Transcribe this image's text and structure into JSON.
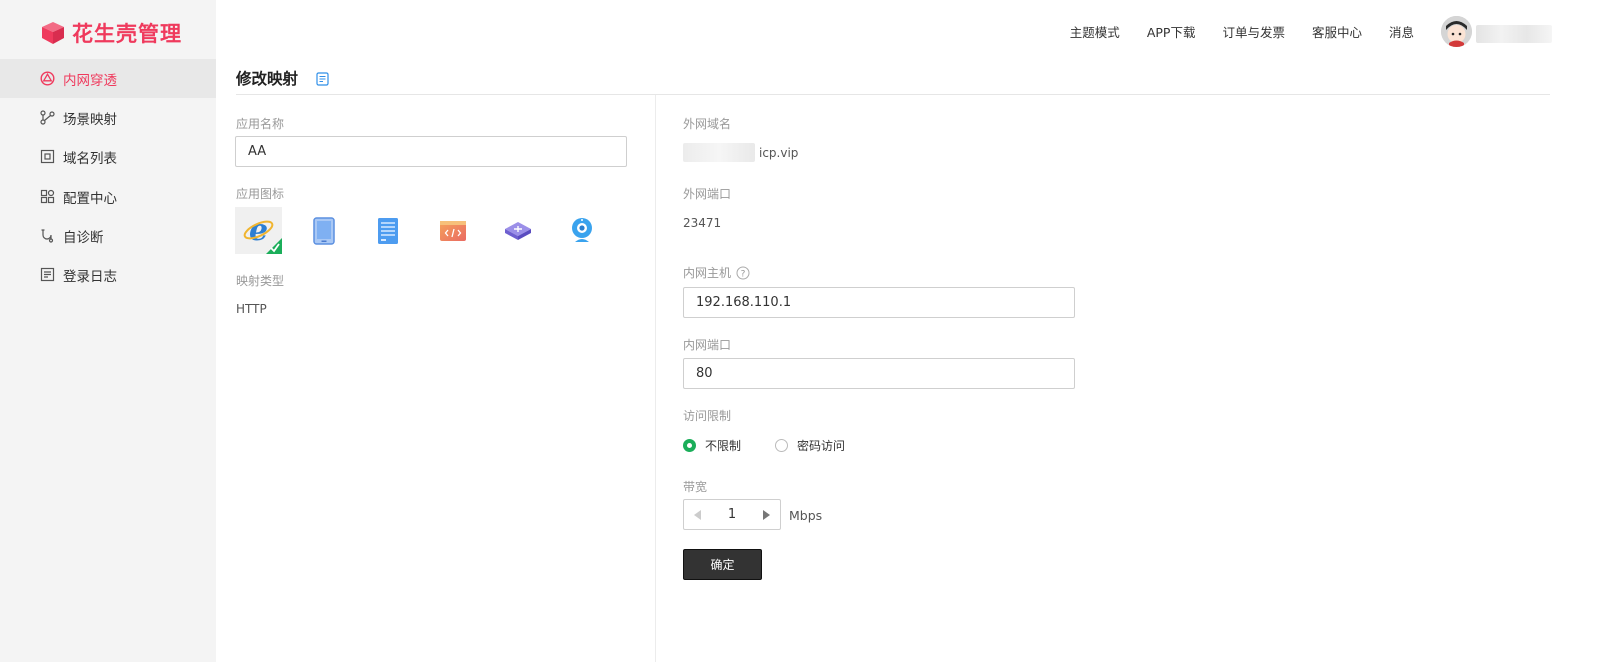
{
  "brand": {
    "name": "花生壳管理",
    "accent": "#ef3a5d"
  },
  "sidebar": {
    "items": [
      {
        "label": "内网穿透",
        "icon": "network-icon",
        "active": true
      },
      {
        "label": "场景映射",
        "icon": "branch-icon",
        "active": false
      },
      {
        "label": "域名列表",
        "icon": "domain-icon",
        "active": false
      },
      {
        "label": "配置中心",
        "icon": "grid-icon",
        "active": false
      },
      {
        "label": "自诊断",
        "icon": "diagnose-icon",
        "active": false
      },
      {
        "label": "登录日志",
        "icon": "log-icon",
        "active": false
      }
    ]
  },
  "topbar": {
    "links": [
      "主题模式",
      "APP下载",
      "订单与发票",
      "客服中心",
      "消息"
    ]
  },
  "page": {
    "title": "修改映射",
    "title_icon": "document-icon"
  },
  "left_form": {
    "app_name_label": "应用名称",
    "app_name_value": "AA",
    "app_icon_label": "应用图标",
    "icons": [
      "ie-browser-icon",
      "tablet-icon",
      "server-icon",
      "code-icon",
      "router-icon",
      "camera-icon"
    ],
    "selected_icon": "ie-browser-icon",
    "map_type_label": "映射类型",
    "map_type_value": "HTTP"
  },
  "right_form": {
    "domain_label": "外网域名",
    "domain_value": "icp.vip",
    "port_label": "外网端口",
    "port_value": "23471",
    "host_label": "内网主机",
    "host_value": "192.168.110.1",
    "inner_port_label": "内网端口",
    "inner_port_value": "80",
    "access_label": "访问限制",
    "access_options": [
      "不限制",
      "密码访问"
    ],
    "access_selected": "不限制",
    "bandwidth_label": "带宽",
    "bandwidth_value": "1",
    "bandwidth_unit": "Mbps",
    "confirm_label": "确定"
  },
  "colors": {
    "success": "#1bae5a",
    "button": "#333333"
  }
}
